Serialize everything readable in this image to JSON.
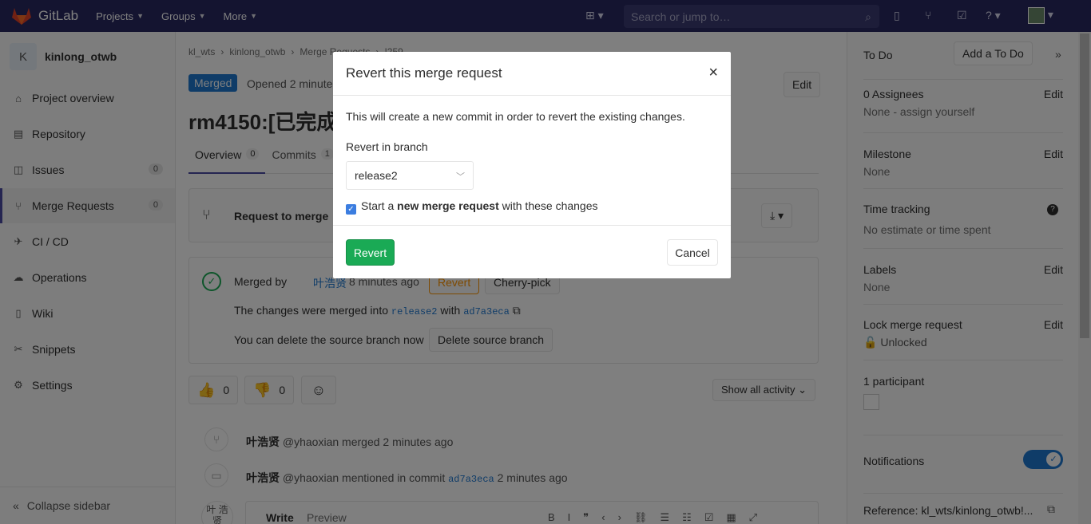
{
  "topnav": {
    "brand": "GitLab",
    "links": [
      "Projects",
      "Groups",
      "More"
    ],
    "search_placeholder": "Search or jump to…"
  },
  "sidebar": {
    "project_letter": "K",
    "project_name": "kinlong_otwb",
    "items": [
      {
        "label": "Project overview"
      },
      {
        "label": "Repository"
      },
      {
        "label": "Issues",
        "count": "0"
      },
      {
        "label": "Merge Requests",
        "count": "0"
      },
      {
        "label": "CI / CD"
      },
      {
        "label": "Operations"
      },
      {
        "label": "Wiki"
      },
      {
        "label": "Snippets"
      },
      {
        "label": "Settings"
      }
    ],
    "collapse": "Collapse sidebar"
  },
  "main": {
    "breadcrumbs": [
      "kl_wts",
      "kinlong_otwb",
      "Merge Requests",
      "!259"
    ],
    "status": "Merged",
    "opened": "Opened 2 minute",
    "edit": "Edit",
    "title": "rm4150:[已完成",
    "tabs": [
      {
        "label": "Overview",
        "count": "0"
      },
      {
        "label": "Commits",
        "count": "1"
      }
    ],
    "request_to_merge": "Request to merge",
    "merged_by": "Merged by",
    "merged_user": "叶浩贤",
    "merged_time": "8 minutes ago",
    "revert_btn": "Revert",
    "cherry_pick": "Cherry-pick",
    "merged_into_prefix": "The changes were merged into",
    "branch": "release2",
    "with": "with",
    "commit": "ad7a3eca",
    "delete_text": "You can delete the source branch now",
    "delete_btn": "Delete source branch",
    "thumbs_up": "0",
    "thumbs_down": "0",
    "show_activity": "Show all activity",
    "activity": [
      {
        "user": "叶浩贤",
        "handle": "@yhaoxian",
        "text": "merged 2 minutes ago"
      },
      {
        "user": "叶浩贤",
        "handle": "@yhaoxian",
        "text": "mentioned in commit",
        "commit": "ad7a3eca",
        "time": "2 minutes ago"
      }
    ],
    "write": "Write",
    "preview": "Preview",
    "avatar_alt": "叶 浩贤"
  },
  "right": {
    "todo": "To Do",
    "add_todo": "Add a To Do",
    "assignees": "0 Assignees",
    "assignees_val": "None - assign yourself",
    "milestone": "Milestone",
    "milestone_val": "None",
    "time_tracking": "Time tracking",
    "time_val": "No estimate or time spent",
    "labels": "Labels",
    "labels_val": "None",
    "lock": "Lock merge request",
    "lock_val": "Unlocked",
    "participants": "1 participant",
    "notifications": "Notifications",
    "reference": "Reference: kl_wts/kinlong_otwb!...",
    "edit": "Edit"
  },
  "modal": {
    "title": "Revert this merge request",
    "description": "This will create a new commit in order to revert the existing changes.",
    "branch_label": "Revert in branch",
    "branch_value": "release2",
    "checkbox_prefix": "Start a",
    "checkbox_bold": "new merge request",
    "checkbox_suffix": "with these changes",
    "revert": "Revert",
    "cancel": "Cancel"
  },
  "colors": {
    "nav": "#292961",
    "accent": "#1f78d1",
    "success": "#1aaa55"
  }
}
